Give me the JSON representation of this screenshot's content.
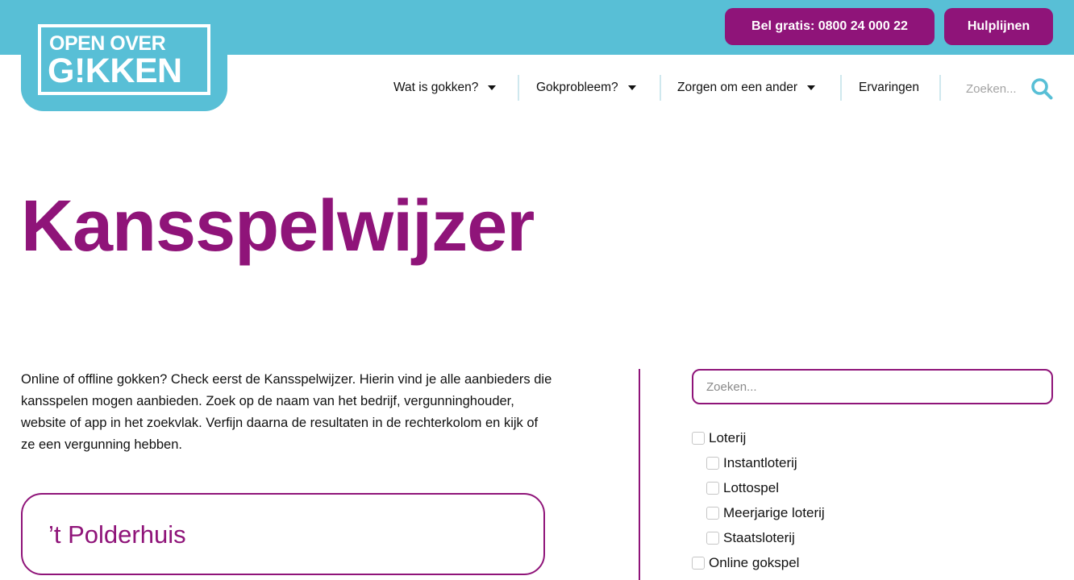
{
  "topbar": {
    "call_label": "Bel gratis: 0800 24 000 22",
    "help_label": "Hulplijnen"
  },
  "logo": {
    "line1": "OPEN OVER",
    "line2": "G!KKEN"
  },
  "nav": {
    "items": [
      {
        "label": "Wat is gokken?",
        "has_dropdown": true
      },
      {
        "label": "Gokprobleem?",
        "has_dropdown": true
      },
      {
        "label": "Zorgen om een ander",
        "has_dropdown": true
      },
      {
        "label": "Ervaringen",
        "has_dropdown": false
      }
    ],
    "search_placeholder": "Zoeken..."
  },
  "page": {
    "title": "Kansspelwijzer",
    "intro": "Online of offline gokken? Check eerst de Kansspelwijzer. Hierin vind je alle aanbieders die kansspelen mogen aanbieden. Zoek op de naam van het bedrijf, vergunninghouder, website of app in het zoekvlak. Verfijn daarna de resultaten in de rechterkolom en kijk of ze een vergunning hebben."
  },
  "results": [
    {
      "name": "’t Polderhuis"
    }
  ],
  "filters": {
    "search_placeholder": "Zoeken...",
    "options": [
      {
        "label": "Loterij",
        "level": 0,
        "checked": false
      },
      {
        "label": "Instantloterij",
        "level": 1,
        "checked": false
      },
      {
        "label": "Lottospel",
        "level": 1,
        "checked": false
      },
      {
        "label": "Meerjarige loterij",
        "level": 1,
        "checked": false
      },
      {
        "label": "Staatsloterij",
        "level": 1,
        "checked": false
      },
      {
        "label": "Online gokspel",
        "level": 0,
        "checked": false
      }
    ]
  },
  "colors": {
    "brand_blue": "#58bfd6",
    "brand_purple": "#8f1479"
  },
  "icons": [
    "search-icon",
    "caret-down-icon",
    "checkbox-icon"
  ]
}
